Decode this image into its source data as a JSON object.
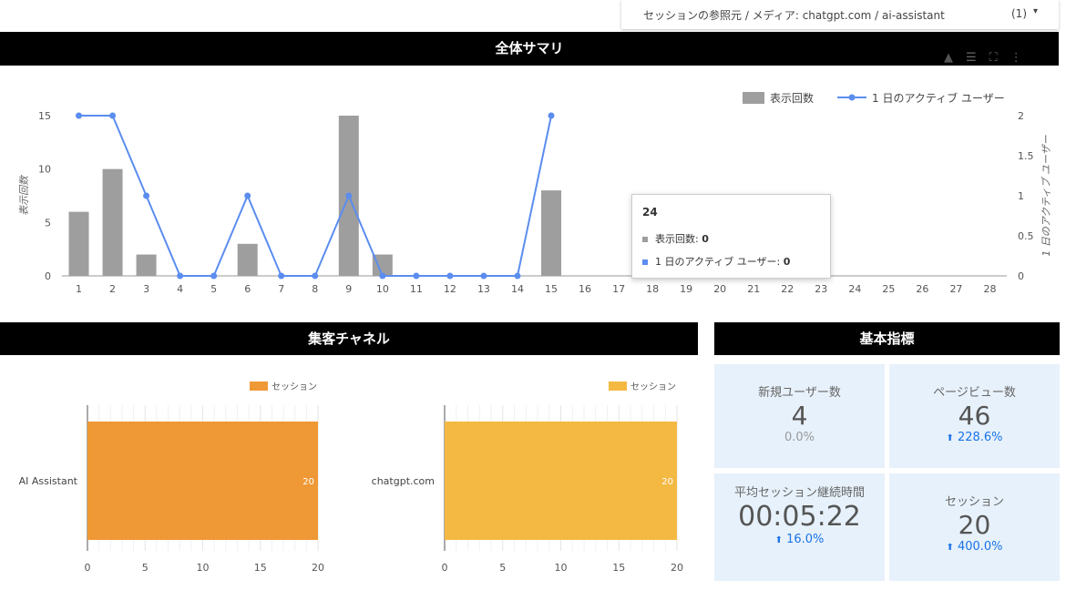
{
  "filter": {
    "label": "セッションの参照元 / メディア: chatgpt.com / ai-assistant",
    "count": "(1)"
  },
  "summary": {
    "title": "全体サマリ"
  },
  "acquisition": {
    "title": "集客チャネル"
  },
  "metrics": {
    "title": "基本指標",
    "cards": [
      {
        "label": "新規ユーザー数",
        "value": "4",
        "delta": "0.0%",
        "trend": "flat"
      },
      {
        "label": "ページビュー数",
        "value": "46",
        "delta": "228.6%",
        "trend": "up"
      },
      {
        "label": "平均セッション継続時間",
        "value": "00:05:22",
        "delta": "16.0%",
        "trend": "up"
      },
      {
        "label": "セッション",
        "value": "20",
        "delta": "400.0%",
        "trend": "up"
      }
    ]
  },
  "tooltip": {
    "day": "24",
    "row1_label": "表示回数: ",
    "row1_value": "0",
    "row2_label": "1 日のアクティブ ユーザー: ",
    "row2_value": "0"
  },
  "colors": {
    "bar": "#9e9e9e",
    "line": "#5b8def",
    "orange": "#ef9836",
    "yellow": "#f4b942",
    "kpi_bg": "#e7f1fb",
    "up": "#1a73e8"
  },
  "chart_data": [
    {
      "type": "bar+line",
      "x": [
        1,
        2,
        3,
        4,
        5,
        6,
        7,
        8,
        9,
        10,
        11,
        12,
        13,
        14,
        15,
        16,
        17,
        18,
        19,
        20,
        21,
        22,
        23,
        24,
        25,
        26,
        27,
        28
      ],
      "series": [
        {
          "name": "表示回数",
          "type": "bar",
          "axis": "left",
          "values": [
            6,
            10,
            2,
            0,
            0,
            3,
            0,
            0,
            15,
            2,
            0,
            0,
            0,
            0,
            8,
            0,
            0,
            0,
            0,
            0,
            0,
            0,
            0,
            0,
            0,
            0,
            0,
            0
          ]
        },
        {
          "name": "1 日のアクティブ ユーザー",
          "type": "line",
          "axis": "right",
          "values": [
            2,
            2,
            1,
            0,
            0,
            1,
            0,
            0,
            1,
            0,
            0,
            0,
            0,
            0,
            2
          ]
        }
      ],
      "ylabel": "表示回数",
      "y2label": "1 日のアクティブ ユーザー",
      "ylim": [
        0,
        15
      ],
      "yticks": [
        0,
        5,
        10,
        15
      ],
      "y2lim": [
        0,
        2
      ],
      "y2ticks": [
        0,
        0.5,
        1,
        1.5,
        2
      ],
      "legend": "top-right",
      "grid": false
    },
    {
      "type": "bar",
      "orientation": "horizontal",
      "categories": [
        "AI Assistant"
      ],
      "series": [
        {
          "name": "セッション",
          "values": [
            20
          ]
        }
      ],
      "xlim": [
        0,
        20
      ],
      "xticks": [
        0,
        5,
        10,
        15,
        20
      ],
      "legend": "top-right",
      "grid": true
    },
    {
      "type": "bar",
      "orientation": "horizontal",
      "categories": [
        "chatgpt.com"
      ],
      "series": [
        {
          "name": "セッション",
          "values": [
            20
          ]
        }
      ],
      "xlim": [
        0,
        20
      ],
      "xticks": [
        0,
        5,
        10,
        15,
        20
      ],
      "legend": "top-right",
      "grid": true
    }
  ]
}
